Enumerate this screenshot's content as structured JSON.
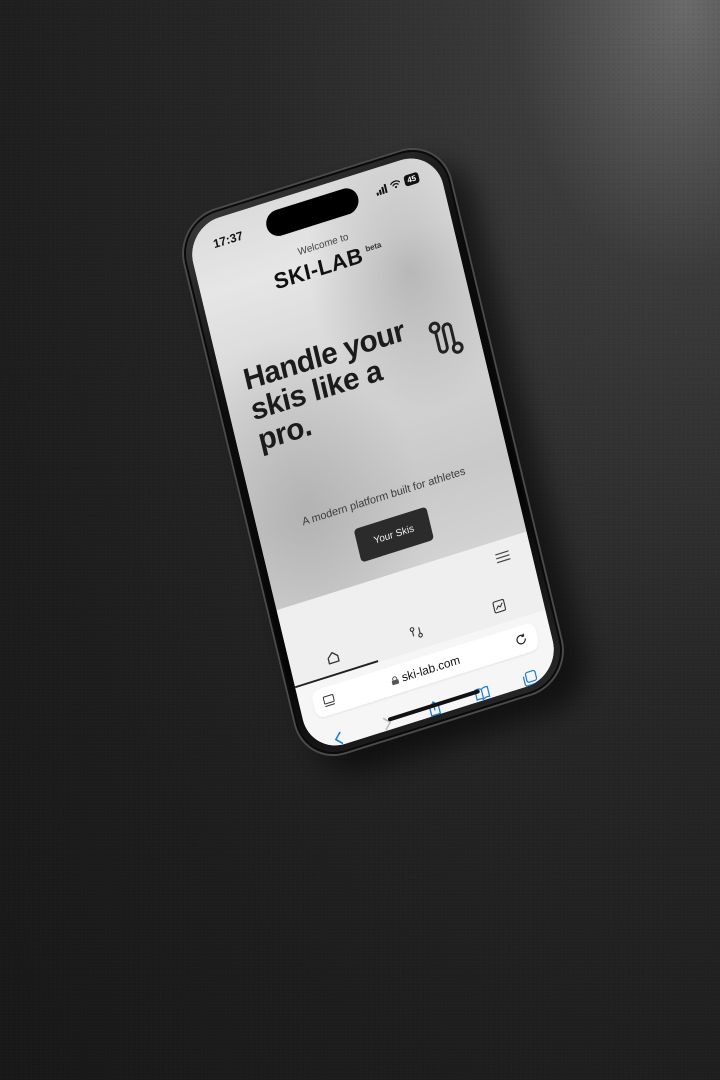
{
  "status_bar": {
    "time": "17:37",
    "battery": "45"
  },
  "header": {
    "welcome": "Welcome to",
    "brand": "SKI-LAB",
    "badge": "beta"
  },
  "hero": {
    "headline": "Handle your skis like a pro.",
    "tagline": "A modern platform built for athletes",
    "cta_label": "Your Skis",
    "hero_icon": "route-icon"
  },
  "app_nav": {
    "menu_icon": "menu-icon",
    "tabs": [
      {
        "icon": "home-icon",
        "active": true
      },
      {
        "icon": "route-icon",
        "active": false
      },
      {
        "icon": "chart-icon",
        "active": false
      }
    ]
  },
  "browser": {
    "url": "ski-lab.com",
    "toolbar_icons": [
      "back-icon",
      "forward-icon",
      "share-icon",
      "bookmarks-icon",
      "tabs-icon"
    ]
  },
  "colors": {
    "accent": "#1a7ad8",
    "button": "#2b2b2b",
    "text": "#1b1b1b"
  }
}
